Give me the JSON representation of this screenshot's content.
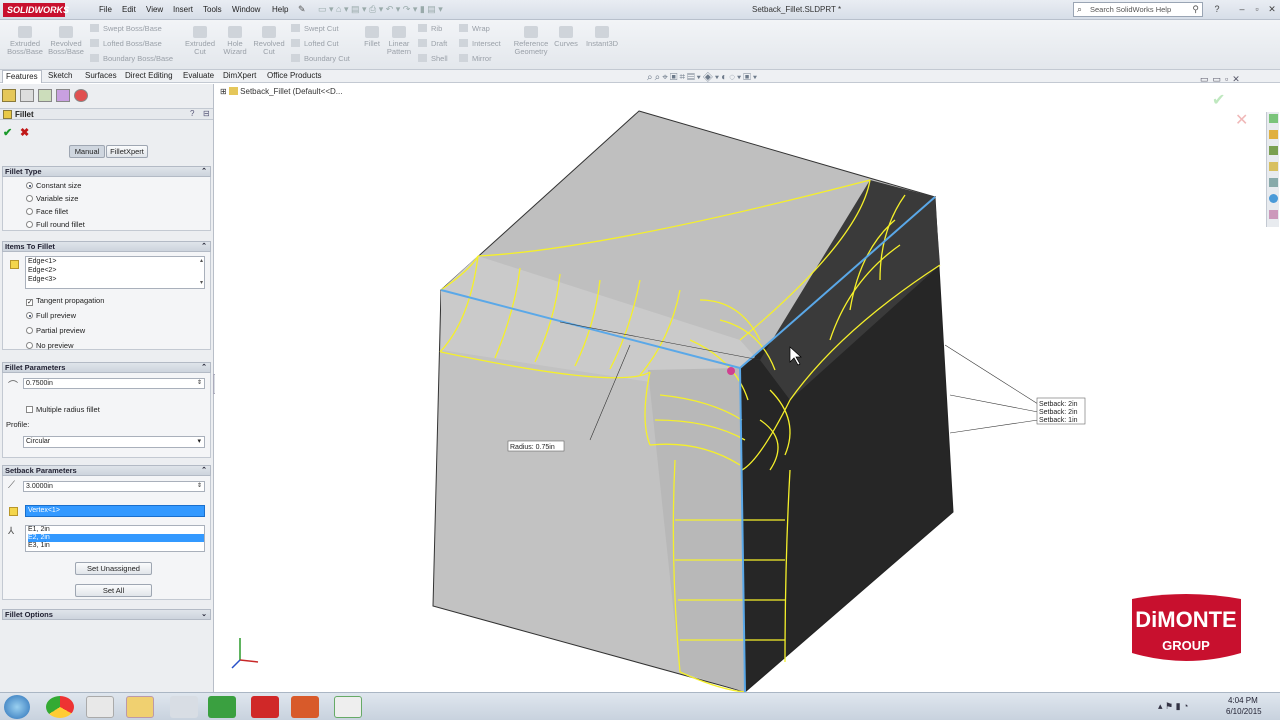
{
  "app": {
    "logo_text": "SOLIDWORKS",
    "doc_title": "Setback_Fillet.SLDPRT *"
  },
  "menus": [
    "File",
    "Edit",
    "View",
    "Insert",
    "Tools",
    "Window",
    "Help"
  ],
  "search": {
    "placeholder": "Search SolidWorks Help"
  },
  "ribbon": {
    "extruded_boss": "Extruded Boss/Base",
    "revolved_boss": "Revolved Boss/Base",
    "swept_boss": "Swept Boss/Base",
    "lofted_boss": "Lofted Boss/Base",
    "boundary_boss": "Boundary Boss/Base",
    "extruded_cut": "Extruded Cut",
    "hole_wizard": "Hole Wizard",
    "revolved_cut": "Revolved Cut",
    "swept_cut": "Swept Cut",
    "lofted_cut": "Lofted Cut",
    "boundary_cut": "Boundary Cut",
    "fillet": "Fillet",
    "linear_pattern": "Linear Pattern",
    "rib": "Rib",
    "draft": "Draft",
    "shell": "Shell",
    "wrap": "Wrap",
    "intersect": "Intersect",
    "mirror": "Mirror",
    "reference_geometry": "Reference Geometry",
    "curves": "Curves",
    "instant3d": "Instant3D"
  },
  "tabs": [
    "Features",
    "Sketch",
    "Surfaces",
    "Direct Editing",
    "Evaluate",
    "DimXpert",
    "Office Products"
  ],
  "tree": {
    "item": "Setback_Fillet  (Default<<D..."
  },
  "panel": {
    "title": "Fillet",
    "mode_manual": "Manual",
    "mode_xpert": "FilletXpert",
    "fillet_type": {
      "header": "Fillet Type",
      "options": [
        "Constant size",
        "Variable size",
        "Face fillet",
        "Full round fillet"
      ]
    },
    "items": {
      "header": "Items To Fillet",
      "edges": [
        "Edge<1>",
        "Edge<2>",
        "Edge<3>"
      ],
      "tangent": "Tangent propagation",
      "full_preview": "Full preview",
      "partial_preview": "Partial preview",
      "no_preview": "No preview"
    },
    "params": {
      "header": "Fillet Parameters",
      "radius": "0.7500in",
      "multiple": "Multiple radius fillet",
      "profile_label": "Profile:",
      "profile": "Circular"
    },
    "setback": {
      "header": "Setback Parameters",
      "distance": "3.0000in",
      "vertex": "Vertex<1>",
      "list": [
        "E1, 2in",
        "E2, 2in",
        "E3, 1in"
      ],
      "set_unassigned": "Set Unassigned",
      "set_all": "Set All"
    },
    "options": {
      "header": "Fillet Options"
    }
  },
  "callouts": {
    "radius": "Radius: 0.75in",
    "setbacks": [
      "Setback: 2in",
      "Setback: 2in",
      "Setback: 1in"
    ]
  },
  "brand": {
    "line1": "DiMONTE",
    "line2": "GROUP"
  },
  "clock": {
    "time": "4:04 PM",
    "date": "6/10/2015"
  }
}
